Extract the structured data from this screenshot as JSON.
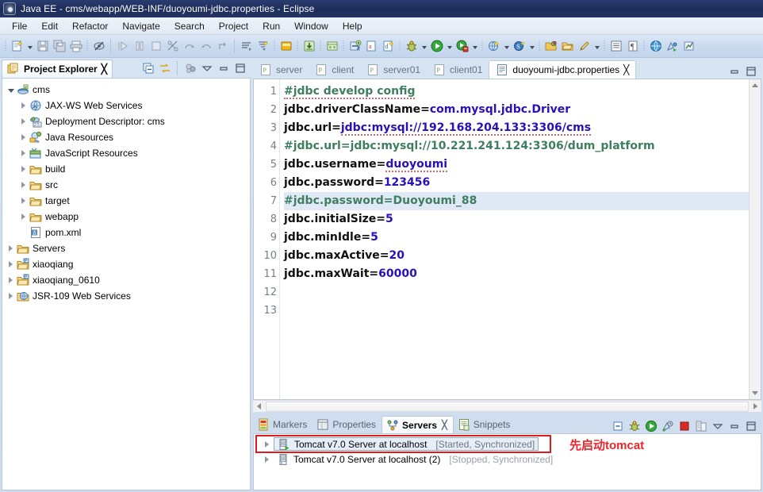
{
  "window": {
    "title": "Java EE - cms/webapp/WEB-INF/duoyoumi-jdbc.properties - Eclipse",
    "icon": "eclipse-icon"
  },
  "menubar": {
    "items": [
      "File",
      "Edit",
      "Refactor",
      "Navigate",
      "Search",
      "Project",
      "Run",
      "Window",
      "Help"
    ]
  },
  "toolbar": {
    "items": [
      "new-wizard-icon",
      "new-dropdown-arrow",
      "save-icon",
      "save-all-icon",
      "print-icon",
      "toggle-mark-occurrences-icon",
      "step-into-icon",
      "suspend-icon",
      "terminate-icon",
      "skip-breakpoints-icon",
      "step-over-icon",
      "step-return-icon",
      "step-into-selection-icon",
      "open-task-icon",
      "search-filter-icon",
      "open-type-icon",
      "import-icon",
      "export-icon",
      "new-java-package-icon",
      "undo-icon",
      "new-annotation-icon",
      "debug-icon",
      "debug-dropdown-arrow",
      "run-icon",
      "run-dropdown-arrow",
      "run-as-server-icon",
      "server-dropdown-arrow",
      "new-web-project-icon",
      "web-dropdown-arrow",
      "new-servlet-icon",
      "servlet-dropdown-arrow",
      "open-folder-icon",
      "open-folder2-icon",
      "pencil-icon",
      "pencil-dropdown-arrow",
      "outline-icon",
      "paragraph-icon",
      "web-browser-icon",
      "run-external-icon",
      "profile-icon"
    ]
  },
  "project_explorer": {
    "title": "Project Explorer",
    "close_glyph": "╳",
    "toolbar": [
      "collapse-all-icon",
      "link-with-editor-icon",
      "focus-on-active-task-icon",
      "view-menu-icon",
      "minimize-icon",
      "maximize-icon"
    ],
    "tree": [
      {
        "label": "cms",
        "icon": "dynamic-web-project-icon",
        "indent": 0,
        "twist": "open"
      },
      {
        "label": "JAX-WS Web Services",
        "icon": "jax-ws-icon",
        "indent": 1,
        "twist": "closed"
      },
      {
        "label": "Deployment Descriptor: cms",
        "icon": "deployment-descriptor-icon",
        "indent": 1,
        "twist": "closed"
      },
      {
        "label": "Java Resources",
        "icon": "java-resources-icon",
        "indent": 1,
        "twist": "closed"
      },
      {
        "label": "JavaScript Resources",
        "icon": "javascript-resources-icon",
        "indent": 1,
        "twist": "closed"
      },
      {
        "label": "build",
        "icon": "folder-icon",
        "indent": 1,
        "twist": "closed"
      },
      {
        "label": "src",
        "icon": "folder-icon",
        "indent": 1,
        "twist": "closed"
      },
      {
        "label": "target",
        "icon": "folder-icon",
        "indent": 1,
        "twist": "closed"
      },
      {
        "label": "webapp",
        "icon": "folder-icon",
        "indent": 1,
        "twist": "closed"
      },
      {
        "label": "pom.xml",
        "icon": "maven-pom-icon",
        "indent": 1,
        "twist": "none"
      },
      {
        "label": "Servers",
        "icon": "folder-icon",
        "indent": 0,
        "twist": "closed"
      },
      {
        "label": "xiaoqiang",
        "icon": "project-icon",
        "indent": 0,
        "twist": "closed"
      },
      {
        "label": "xiaoqiang_0610",
        "icon": "project-icon",
        "indent": 0,
        "twist": "closed"
      },
      {
        "label": "JSR-109 Web Services",
        "icon": "jsr109-icon",
        "indent": 0,
        "twist": "closed"
      }
    ]
  },
  "editor": {
    "tabs": [
      {
        "label": "server",
        "icon": "properties-file-icon",
        "active": false
      },
      {
        "label": "client",
        "icon": "properties-file-icon",
        "active": false
      },
      {
        "label": "server01",
        "icon": "properties-file-icon",
        "active": false
      },
      {
        "label": "client01",
        "icon": "properties-file-icon",
        "active": false
      },
      {
        "label": "duoyoumi-jdbc.properties",
        "icon": "text-file-icon",
        "active": true,
        "close_glyph": "╳"
      }
    ],
    "tab_controls": [
      "minimize-icon",
      "maximize-icon"
    ],
    "lines": [
      {
        "num": "1",
        "highlight": false,
        "segments": [
          {
            "t": "#jdbc develop config",
            "c": "comment",
            "squiggle": true
          }
        ]
      },
      {
        "num": "2",
        "highlight": false,
        "segments": [
          {
            "t": "jdbc.driverClassName=",
            "c": "key"
          },
          {
            "t": "com.mysql.jdbc.Driver",
            "c": "val"
          }
        ]
      },
      {
        "num": "3",
        "highlight": false,
        "segments": [
          {
            "t": "jdbc.url=",
            "c": "key"
          },
          {
            "t": "jdbc:mysql://192.168.204.133:3306/cms",
            "c": "val",
            "squiggle": true
          }
        ]
      },
      {
        "num": "4",
        "highlight": false,
        "segments": [
          {
            "t": "#jdbc.url=jdbc:mysql://10.221.241.124:3306/dum_platform",
            "c": "comment"
          }
        ]
      },
      {
        "num": "5",
        "highlight": false,
        "segments": [
          {
            "t": "jdbc.username=",
            "c": "key"
          },
          {
            "t": "duoyoumi",
            "c": "val",
            "squiggle": true
          }
        ]
      },
      {
        "num": "6",
        "highlight": false,
        "segments": [
          {
            "t": "jdbc.password=",
            "c": "key"
          },
          {
            "t": "123456",
            "c": "val"
          }
        ]
      },
      {
        "num": "7",
        "highlight": true,
        "segments": [
          {
            "t": "#jdbc.password=Duoyoumi_88",
            "c": "comment"
          }
        ]
      },
      {
        "num": "8",
        "highlight": false,
        "segments": [
          {
            "t": "jdbc.initialSize=",
            "c": "key"
          },
          {
            "t": "5",
            "c": "val"
          }
        ]
      },
      {
        "num": "9",
        "highlight": false,
        "segments": [
          {
            "t": "jdbc.minIdle=",
            "c": "key"
          },
          {
            "t": "5",
            "c": "val"
          }
        ]
      },
      {
        "num": "10",
        "highlight": false,
        "segments": [
          {
            "t": "jdbc.maxActive=",
            "c": "key"
          },
          {
            "t": "20",
            "c": "val"
          }
        ]
      },
      {
        "num": "11",
        "highlight": false,
        "segments": [
          {
            "t": "jdbc.maxWait=",
            "c": "key"
          },
          {
            "t": "60000",
            "c": "val"
          }
        ]
      },
      {
        "num": "12",
        "highlight": false,
        "segments": []
      },
      {
        "num": "13",
        "highlight": false,
        "segments": []
      }
    ]
  },
  "bottom_panel": {
    "tabs": [
      {
        "label": "Markers",
        "icon": "markers-icon",
        "active": false
      },
      {
        "label": "Properties",
        "icon": "properties-icon",
        "active": false
      },
      {
        "label": "Servers",
        "icon": "servers-icon",
        "active": true,
        "close_glyph": "╳"
      },
      {
        "label": "Snippets",
        "icon": "snippets-icon",
        "active": false
      }
    ],
    "toolbar": [
      "collapse-all-icon",
      "debug-server-icon",
      "start-server-icon",
      "profile-server-icon",
      "stop-server-icon",
      "publish-icon",
      "view-menu-icon",
      "minimize-icon",
      "maximize-icon"
    ],
    "servers": [
      {
        "name": "Tomcat v7.0 Server at localhost",
        "state": "[Started, Synchronized]",
        "selected": true,
        "running": true
      },
      {
        "name": "Tomcat v7.0 Server at localhost (2)",
        "state": "[Stopped, Synchronized]",
        "selected": false,
        "running": false
      }
    ],
    "annotation": {
      "text": "先启动tomcat",
      "color": "#e8252a"
    }
  },
  "colors": {
    "title_bar": "#223462",
    "comment_green": "#3f7f5f",
    "value_blue": "#2a10b8",
    "highlight_line": "#dfeaf6",
    "annotation_red": "#e01b1b"
  }
}
